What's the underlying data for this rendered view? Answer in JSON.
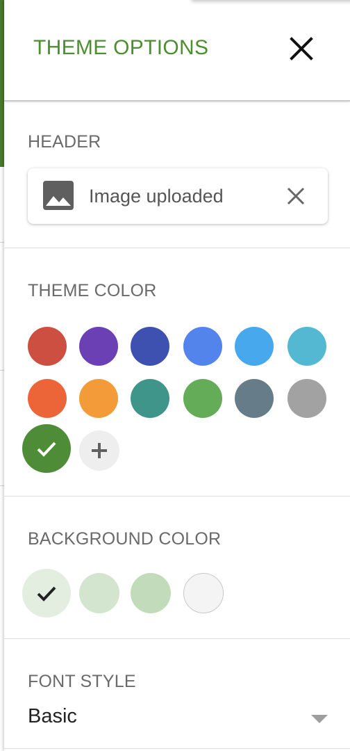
{
  "panel": {
    "title": "THEME OPTIONS",
    "close_icon": "close-icon"
  },
  "header_section": {
    "label": "HEADER",
    "upload": {
      "icon": "image-icon",
      "text": "Image uploaded",
      "remove_icon": "close-icon"
    }
  },
  "theme_color_section": {
    "label": "THEME COLOR",
    "colors": [
      {
        "hex": "#cd4f42",
        "selected": false
      },
      {
        "hex": "#6b40b5",
        "selected": false
      },
      {
        "hex": "#3f51b0",
        "selected": false
      },
      {
        "hex": "#5284ec",
        "selected": false
      },
      {
        "hex": "#47a8ee",
        "selected": false
      },
      {
        "hex": "#54b8d2",
        "selected": false
      },
      {
        "hex": "#ec6538",
        "selected": false
      },
      {
        "hex": "#f29b38",
        "selected": false
      },
      {
        "hex": "#40958a",
        "selected": false
      },
      {
        "hex": "#65ac59",
        "selected": false
      },
      {
        "hex": "#677c89",
        "selected": false
      },
      {
        "hex": "#a2a2a2",
        "selected": false
      },
      {
        "hex": "#4e8c37",
        "selected": true
      }
    ],
    "add_icon": "plus-icon"
  },
  "background_color_section": {
    "label": "BACKGROUND COLOR",
    "colors": [
      {
        "hex": "#e3eee0",
        "selected": true
      },
      {
        "hex": "#d4e5cf",
        "selected": false
      },
      {
        "hex": "#c2dbba",
        "selected": false
      },
      {
        "hex": "#f4f4f4",
        "selected": false
      }
    ]
  },
  "font_style_section": {
    "label": "FONT STYLE",
    "value": "Basic",
    "dropdown_icon": "dropdown-arrow-icon"
  },
  "accent_color": "#4c8f2e"
}
